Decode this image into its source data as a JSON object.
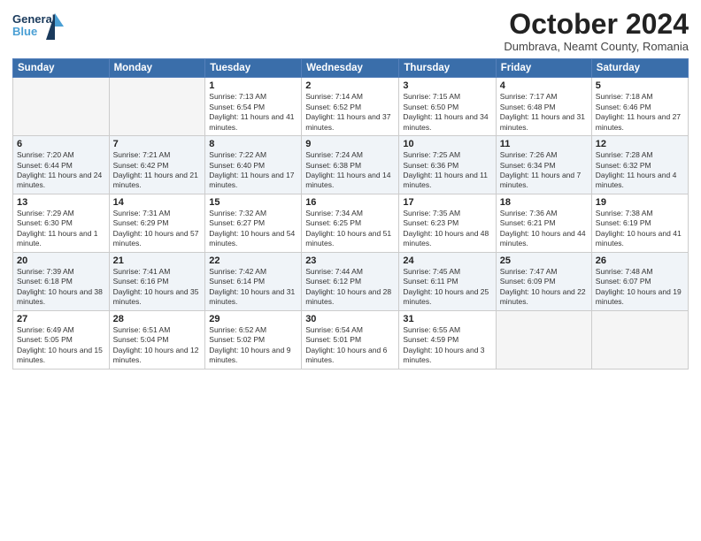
{
  "header": {
    "logo_line1": "General",
    "logo_line2": "Blue",
    "month_title": "October 2024",
    "subtitle": "Dumbrava, Neamt County, Romania"
  },
  "days_of_week": [
    "Sunday",
    "Monday",
    "Tuesday",
    "Wednesday",
    "Thursday",
    "Friday",
    "Saturday"
  ],
  "weeks": [
    [
      {
        "num": "",
        "info": ""
      },
      {
        "num": "",
        "info": ""
      },
      {
        "num": "1",
        "info": "Sunrise: 7:13 AM\nSunset: 6:54 PM\nDaylight: 11 hours and 41 minutes."
      },
      {
        "num": "2",
        "info": "Sunrise: 7:14 AM\nSunset: 6:52 PM\nDaylight: 11 hours and 37 minutes."
      },
      {
        "num": "3",
        "info": "Sunrise: 7:15 AM\nSunset: 6:50 PM\nDaylight: 11 hours and 34 minutes."
      },
      {
        "num": "4",
        "info": "Sunrise: 7:17 AM\nSunset: 6:48 PM\nDaylight: 11 hours and 31 minutes."
      },
      {
        "num": "5",
        "info": "Sunrise: 7:18 AM\nSunset: 6:46 PM\nDaylight: 11 hours and 27 minutes."
      }
    ],
    [
      {
        "num": "6",
        "info": "Sunrise: 7:20 AM\nSunset: 6:44 PM\nDaylight: 11 hours and 24 minutes."
      },
      {
        "num": "7",
        "info": "Sunrise: 7:21 AM\nSunset: 6:42 PM\nDaylight: 11 hours and 21 minutes."
      },
      {
        "num": "8",
        "info": "Sunrise: 7:22 AM\nSunset: 6:40 PM\nDaylight: 11 hours and 17 minutes."
      },
      {
        "num": "9",
        "info": "Sunrise: 7:24 AM\nSunset: 6:38 PM\nDaylight: 11 hours and 14 minutes."
      },
      {
        "num": "10",
        "info": "Sunrise: 7:25 AM\nSunset: 6:36 PM\nDaylight: 11 hours and 11 minutes."
      },
      {
        "num": "11",
        "info": "Sunrise: 7:26 AM\nSunset: 6:34 PM\nDaylight: 11 hours and 7 minutes."
      },
      {
        "num": "12",
        "info": "Sunrise: 7:28 AM\nSunset: 6:32 PM\nDaylight: 11 hours and 4 minutes."
      }
    ],
    [
      {
        "num": "13",
        "info": "Sunrise: 7:29 AM\nSunset: 6:30 PM\nDaylight: 11 hours and 1 minute."
      },
      {
        "num": "14",
        "info": "Sunrise: 7:31 AM\nSunset: 6:29 PM\nDaylight: 10 hours and 57 minutes."
      },
      {
        "num": "15",
        "info": "Sunrise: 7:32 AM\nSunset: 6:27 PM\nDaylight: 10 hours and 54 minutes."
      },
      {
        "num": "16",
        "info": "Sunrise: 7:34 AM\nSunset: 6:25 PM\nDaylight: 10 hours and 51 minutes."
      },
      {
        "num": "17",
        "info": "Sunrise: 7:35 AM\nSunset: 6:23 PM\nDaylight: 10 hours and 48 minutes."
      },
      {
        "num": "18",
        "info": "Sunrise: 7:36 AM\nSunset: 6:21 PM\nDaylight: 10 hours and 44 minutes."
      },
      {
        "num": "19",
        "info": "Sunrise: 7:38 AM\nSunset: 6:19 PM\nDaylight: 10 hours and 41 minutes."
      }
    ],
    [
      {
        "num": "20",
        "info": "Sunrise: 7:39 AM\nSunset: 6:18 PM\nDaylight: 10 hours and 38 minutes."
      },
      {
        "num": "21",
        "info": "Sunrise: 7:41 AM\nSunset: 6:16 PM\nDaylight: 10 hours and 35 minutes."
      },
      {
        "num": "22",
        "info": "Sunrise: 7:42 AM\nSunset: 6:14 PM\nDaylight: 10 hours and 31 minutes."
      },
      {
        "num": "23",
        "info": "Sunrise: 7:44 AM\nSunset: 6:12 PM\nDaylight: 10 hours and 28 minutes."
      },
      {
        "num": "24",
        "info": "Sunrise: 7:45 AM\nSunset: 6:11 PM\nDaylight: 10 hours and 25 minutes."
      },
      {
        "num": "25",
        "info": "Sunrise: 7:47 AM\nSunset: 6:09 PM\nDaylight: 10 hours and 22 minutes."
      },
      {
        "num": "26",
        "info": "Sunrise: 7:48 AM\nSunset: 6:07 PM\nDaylight: 10 hours and 19 minutes."
      }
    ],
    [
      {
        "num": "27",
        "info": "Sunrise: 6:49 AM\nSunset: 5:05 PM\nDaylight: 10 hours and 15 minutes."
      },
      {
        "num": "28",
        "info": "Sunrise: 6:51 AM\nSunset: 5:04 PM\nDaylight: 10 hours and 12 minutes."
      },
      {
        "num": "29",
        "info": "Sunrise: 6:52 AM\nSunset: 5:02 PM\nDaylight: 10 hours and 9 minutes."
      },
      {
        "num": "30",
        "info": "Sunrise: 6:54 AM\nSunset: 5:01 PM\nDaylight: 10 hours and 6 minutes."
      },
      {
        "num": "31",
        "info": "Sunrise: 6:55 AM\nSunset: 4:59 PM\nDaylight: 10 hours and 3 minutes."
      },
      {
        "num": "",
        "info": ""
      },
      {
        "num": "",
        "info": ""
      }
    ]
  ]
}
